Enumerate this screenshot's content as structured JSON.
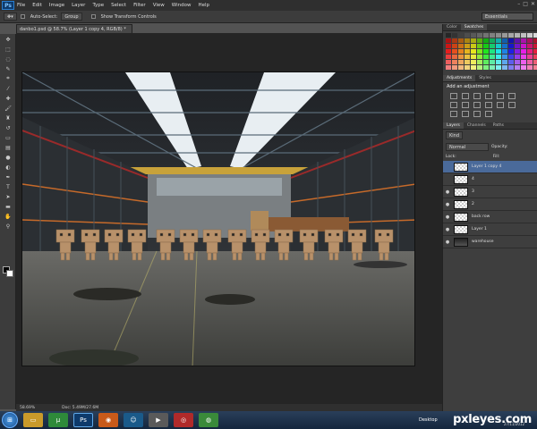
{
  "menu": {
    "logo": "Ps",
    "items": [
      "File",
      "Edit",
      "Image",
      "Layer",
      "Type",
      "Select",
      "Filter",
      "View",
      "Window",
      "Help"
    ]
  },
  "options": {
    "auto_select_label": "Auto-Select:",
    "auto_select_value": "Group",
    "show_transform_label": "Show Transform Controls",
    "workspace": "Essentials"
  },
  "document": {
    "tab_title": "danbo1.psd @ 58.7% (Layer 1 copy 4, RGB/8) *",
    "zoom": "58.69%",
    "doc_size": "Doc: 5.49M/27.6M"
  },
  "panels": {
    "color_tab": "Color",
    "swatches_tab": "Swatches",
    "adjustments_tab": "Adjustments",
    "styles_tab": "Styles",
    "add_adjustment": "Add an adjustment",
    "layers_tab": "Layers",
    "channels_tab": "Channels",
    "paths_tab": "Paths",
    "kind": "Kind",
    "blend_mode": "Normal",
    "opacity_label": "Opacity:",
    "lock_label": "Lock:",
    "fill_label": "Fill:"
  },
  "layers": [
    {
      "name": "Layer 1 copy 4",
      "selected": true,
      "visible": false
    },
    {
      "name": "4",
      "selected": false,
      "visible": false
    },
    {
      "name": "3",
      "selected": false,
      "visible": true
    },
    {
      "name": "2",
      "selected": false,
      "visible": true
    },
    {
      "name": "back row",
      "selected": false,
      "visible": true
    },
    {
      "name": "Layer 1",
      "selected": false,
      "visible": true
    },
    {
      "name": "warehouse",
      "selected": false,
      "visible": true
    }
  ],
  "taskbar": {
    "start": "⊞",
    "desktop_label": "Desktop",
    "watermark": "pxleyes.com",
    "date": "27/11/2012"
  },
  "colors": {
    "selected_layer": "#4a6a9a",
    "panel_bg": "#3e3e3e",
    "workspace_bg": "#252525"
  }
}
